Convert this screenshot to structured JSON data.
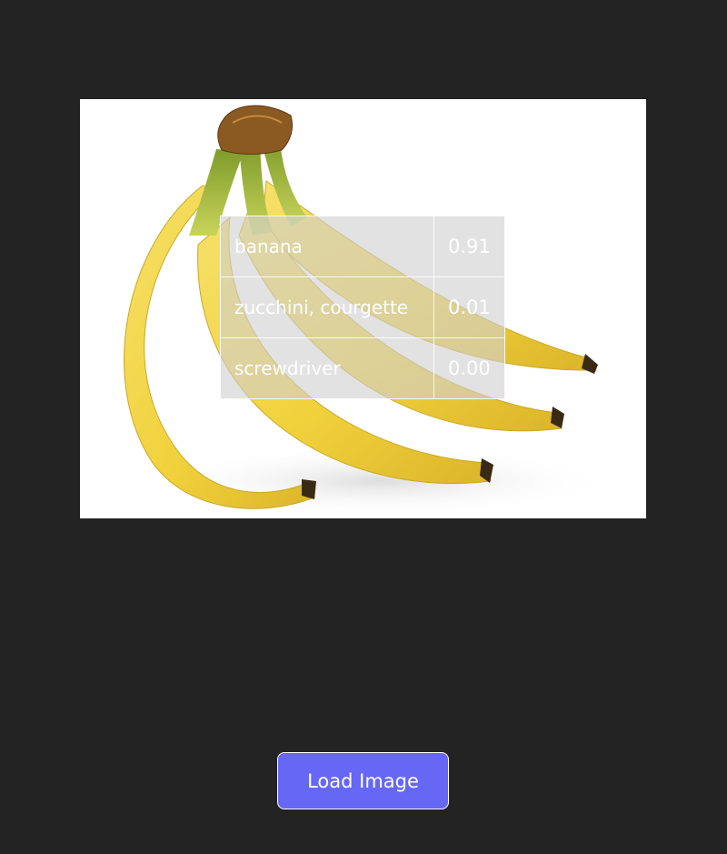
{
  "image": {
    "subject": "bunch of bananas",
    "predictions": [
      {
        "label": "banana",
        "score": "0.91"
      },
      {
        "label": "zucchini, courgette",
        "score": "0.01"
      },
      {
        "label": "screwdriver",
        "score": "0.00"
      }
    ]
  },
  "controls": {
    "load_button_label": "Load Image"
  },
  "colors": {
    "page_background": "#232323",
    "button_background": "#6667f5",
    "banana_yellow": "#f2d545"
  }
}
